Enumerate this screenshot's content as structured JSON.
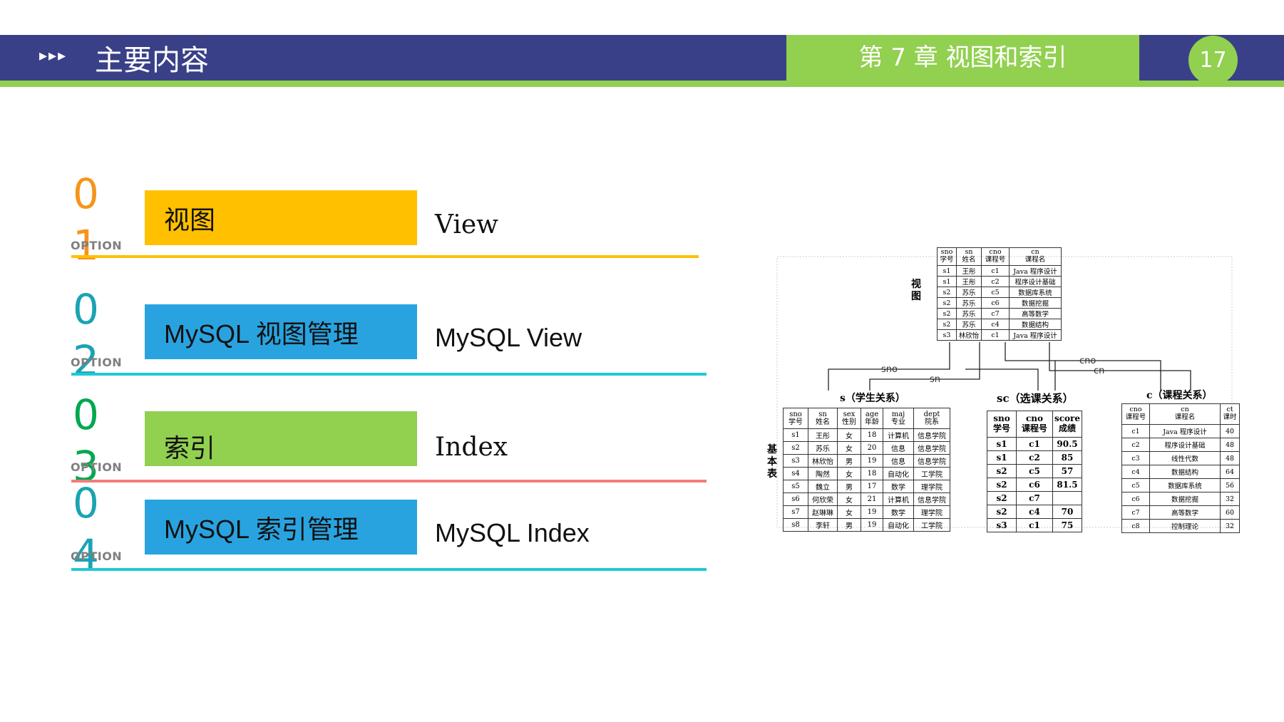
{
  "header": {
    "arrows": "▸▸▸",
    "title": "主要内容",
    "chapter": "第 7 章  视图和索引",
    "page_number": "17"
  },
  "colors": {
    "header_blue": "#3a4087",
    "accent_green": "#92d050",
    "orange": "#f7941d",
    "gold": "#ffc000",
    "cyan": "#1fc9d4",
    "teal_num": "#1aa3b3",
    "green_num": "#00a850",
    "blue_box": "#29a3e0",
    "red_line": "#f47c7c"
  },
  "items": [
    {
      "num": "01",
      "option": "OPTION",
      "label": "视图",
      "english": "View"
    },
    {
      "num": "02",
      "option": "OPTION",
      "label": "MySQL 视图管理",
      "english": "MySQL View"
    },
    {
      "num": "03",
      "option": "OPTION",
      "label": "索引",
      "english": "Index"
    },
    {
      "num": "04",
      "option": "OPTION",
      "label": "MySQL 索引管理",
      "english": "MySQL Index"
    }
  ],
  "diagram": {
    "view_label": "视图",
    "base_label": "基本表",
    "join_labels": {
      "sno": "sno",
      "sn": "sn",
      "cno": "cno",
      "cn": "cn"
    },
    "view_table": {
      "headers": [
        [
          "sno",
          "学号"
        ],
        [
          "sn",
          "姓名"
        ],
        [
          "cno",
          "课程号"
        ],
        [
          "cn",
          "课程名"
        ]
      ],
      "rows": [
        [
          "s1",
          "王彤",
          "c1",
          "Java 程序设计"
        ],
        [
          "s1",
          "王彤",
          "c2",
          "程序设计基础"
        ],
        [
          "s2",
          "苏乐",
          "c5",
          "数据库系统"
        ],
        [
          "s2",
          "苏乐",
          "c6",
          "数据挖掘"
        ],
        [
          "s2",
          "苏乐",
          "c7",
          "高等数学"
        ],
        [
          "s2",
          "苏乐",
          "c4",
          "数据结构"
        ],
        [
          "s3",
          "林欣怡",
          "c1",
          "Java 程序设计"
        ]
      ]
    },
    "s_table": {
      "title": "s（学生关系）",
      "headers": [
        [
          "sno",
          "学号"
        ],
        [
          "sn",
          "姓名"
        ],
        [
          "sex",
          "性别"
        ],
        [
          "age",
          "年龄"
        ],
        [
          "maj",
          "专业"
        ],
        [
          "dept",
          "院系"
        ]
      ],
      "rows": [
        [
          "s1",
          "王彤",
          "女",
          "18",
          "计算机",
          "信息学院"
        ],
        [
          "s2",
          "苏乐",
          "女",
          "20",
          "信息",
          "信息学院"
        ],
        [
          "s3",
          "林欣怡",
          "男",
          "19",
          "信息",
          "信息学院"
        ],
        [
          "s4",
          "陶然",
          "女",
          "18",
          "自动化",
          "工学院"
        ],
        [
          "s5",
          "魏立",
          "男",
          "17",
          "数学",
          "理学院"
        ],
        [
          "s6",
          "何欣荣",
          "女",
          "21",
          "计算机",
          "信息学院"
        ],
        [
          "s7",
          "赵琳琳",
          "女",
          "19",
          "数学",
          "理学院"
        ],
        [
          "s8",
          "李轩",
          "男",
          "19",
          "自动化",
          "工学院"
        ]
      ]
    },
    "sc_table": {
      "title": "sc（选课关系）",
      "headers": [
        [
          "sno",
          "学号"
        ],
        [
          "cno",
          "课程号"
        ],
        [
          "score",
          "成绩"
        ]
      ],
      "rows": [
        [
          "s1",
          "c1",
          "90.5"
        ],
        [
          "s1",
          "c2",
          "85"
        ],
        [
          "s2",
          "c5",
          "57"
        ],
        [
          "s2",
          "c6",
          "81.5"
        ],
        [
          "s2",
          "c7",
          ""
        ],
        [
          "s2",
          "c4",
          "70"
        ],
        [
          "s3",
          "c1",
          "75"
        ]
      ]
    },
    "c_table": {
      "title": "c（课程关系）",
      "headers": [
        [
          "cno",
          "课程号"
        ],
        [
          "cn",
          "课程名"
        ],
        [
          "ct",
          "课时"
        ]
      ],
      "rows": [
        [
          "c1",
          "Java 程序设计",
          "40"
        ],
        [
          "c2",
          "程序设计基础",
          "48"
        ],
        [
          "c3",
          "线性代数",
          "48"
        ],
        [
          "c4",
          "数据结构",
          "64"
        ],
        [
          "c5",
          "数据库系统",
          "56"
        ],
        [
          "c6",
          "数据挖掘",
          "32"
        ],
        [
          "c7",
          "高等数学",
          "60"
        ],
        [
          "c8",
          "控制理论",
          "32"
        ]
      ]
    }
  }
}
